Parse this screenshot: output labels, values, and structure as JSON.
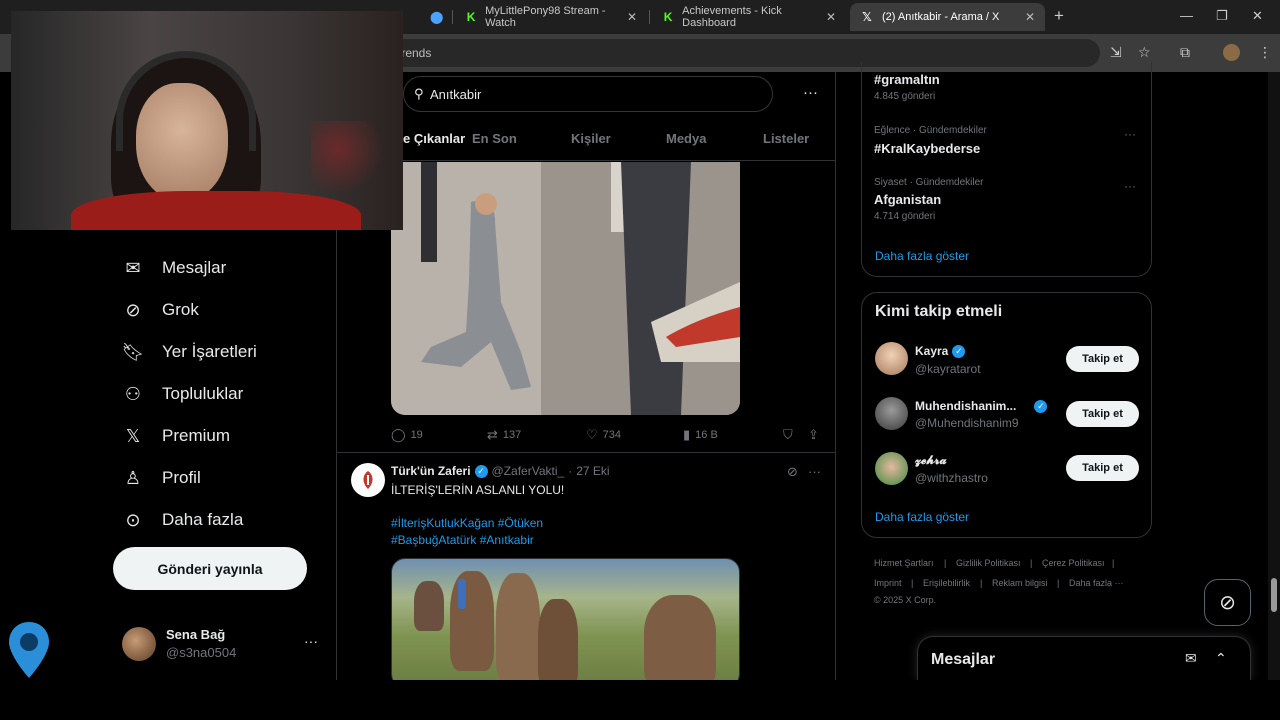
{
  "browser": {
    "tabs": [
      {
        "title": "MyLittlePony98 Stream - Watch",
        "icon": "kick-icon",
        "active": false
      },
      {
        "title": "Achievements - Kick Dashboard",
        "icon": "kick-icon",
        "active": false
      },
      {
        "title": "(2) Anıtkabir - Arama / X",
        "icon": "x-icon",
        "active": true
      }
    ],
    "url_fragment": "trends"
  },
  "nav": {
    "items": [
      {
        "label": "Mesajlar",
        "icon": "mail-icon"
      },
      {
        "label": "Grok",
        "icon": "grok-icon"
      },
      {
        "label": "Yer İşaretleri",
        "icon": "bookmark-icon"
      },
      {
        "label": "Topluluklar",
        "icon": "communities-icon"
      },
      {
        "label": "Premium",
        "icon": "x-logo-icon"
      },
      {
        "label": "Profil",
        "icon": "profile-icon"
      },
      {
        "label": "Daha fazla",
        "icon": "more-circle-icon"
      }
    ],
    "post_button": "Gönderi yayınla",
    "account": {
      "name": "Sena Bağ",
      "handle": "@s3na0504"
    }
  },
  "search": {
    "query": "Anıtkabir"
  },
  "search_tabs": [
    "Öne Çıkanlar",
    "En Son",
    "Kişiler",
    "Medya",
    "Listeler"
  ],
  "tweet1": {
    "stats": {
      "replies": "19",
      "retweets": "137",
      "likes": "734",
      "views": "16 B"
    }
  },
  "tweet2": {
    "name": "Türk'ün Zaferi",
    "handle": "@ZaferVakti_",
    "sep": "·",
    "date": "27 Eki",
    "text": "İLTERİŞ'LERİN ASLANLI YOLU!",
    "tags_line1": "#İlterişKutlukKağan #Ötüken",
    "tags_line2": "#BaşbuğAtatürk #Anıtkabir"
  },
  "trends": {
    "items": [
      {
        "category": "",
        "tag": "#gramaltın",
        "count": "4.845 gönderi"
      },
      {
        "category": "Eğlence · Gündemdekiler",
        "tag": "#KralKaybederse",
        "count": ""
      },
      {
        "category": "Siyaset · Gündemdekiler",
        "tag": "Afganistan",
        "count": "4.714 gönderi"
      }
    ],
    "show_more": "Daha fazla göster"
  },
  "who_to_follow": {
    "title": "Kimi takip etmeli",
    "users": [
      {
        "name": "Kayra",
        "handle": "@kayratarot",
        "button": "Takip et"
      },
      {
        "name": "Muhendishanim...",
        "handle": "@Muhendishanim9",
        "button": "Takip et"
      },
      {
        "name": "𝔃𝓮𝓱𝓻𝓪",
        "handle": "@withzhastro",
        "button": "Takip et"
      }
    ],
    "show_more": "Daha fazla göster"
  },
  "footer": {
    "links_row1": [
      "Hizmet Şartları",
      "|",
      "Gizlilik Politikası",
      "|",
      "Çerez Politikası",
      "|"
    ],
    "links_row2": [
      "Imprint",
      "|",
      "Erişilebilirlik",
      "|",
      "Reklam bilgisi",
      "|",
      "Daha fazla ···"
    ],
    "copyright": "© 2025 X Corp."
  },
  "messages_drawer": {
    "title": "Mesajlar"
  },
  "colors": {
    "accent": "#1d9bf0",
    "background": "#000000",
    "border": "#2f3336",
    "muted": "#71767b"
  }
}
